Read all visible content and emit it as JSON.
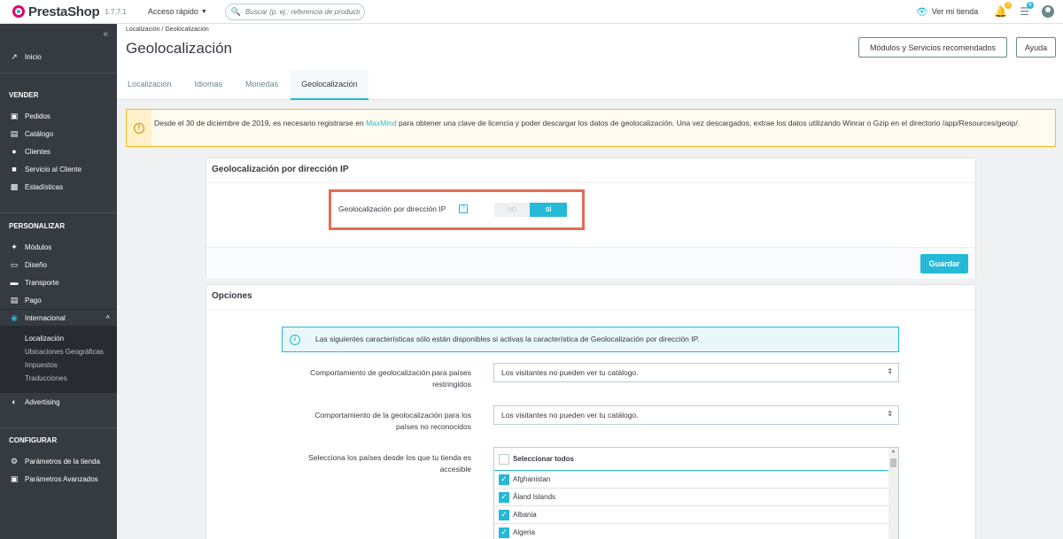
{
  "header": {
    "logo_text": "PrestaShop",
    "version": "1.7.7.1",
    "quick_access": "Acceso rápido",
    "search_placeholder": "Buscar (p. ej.: referencia de producto, nombre de cliente...)",
    "view_store": "Ver mi tienda",
    "notif_orders_count": "2",
    "notif_customers_count": "6"
  },
  "sidebar": {
    "inicio": "Inicio",
    "section_vender": "VENDER",
    "pedidos": "Pedidos",
    "catalogo": "Catálogo",
    "clientes": "Clientes",
    "servicio": "Servicio al Cliente",
    "estadisticas": "Estadísticas",
    "section_personalizar": "PERSONALIZAR",
    "modulos": "Módulos",
    "diseno": "Diseño",
    "transporte": "Transporte",
    "pago": "Pago",
    "internacional": "Internacional",
    "sub_localizacion": "Localización",
    "sub_ubicaciones": "Ubicaciones Geográficas",
    "sub_impuestos": "Impuestos",
    "sub_traducciones": "Traducciones",
    "advertising": "Advertising",
    "section_configurar": "CONFIGURAR",
    "parametros_tienda": "Parámetros de la tienda",
    "parametros_avanzados": "Parámetros Avanzados"
  },
  "page": {
    "breadcrumb": "Localización  /  Geolocalización",
    "title": "Geolocalización",
    "btn_modules": "Módulos y Servicios recomendados",
    "btn_help": "Ayuda",
    "tabs": [
      "Localización",
      "Idiomas",
      "Monedas",
      "Geolocalización"
    ]
  },
  "warning": {
    "before_link": "Desde el 30 de diciembre de 2019, es necesario registrarse en ",
    "link": "MaxMind",
    "after_link": " para obtener una clave de licencia y poder descargar los datos de geolocalización. Una vez descargados, extrae los datos utilizando Winrar o Gzip en el directorio /app/Resources/geoip/."
  },
  "panel_ip": {
    "title": "Geolocalización por dirección IP",
    "field_label": "Geolocalización por dirección IP",
    "help": "?",
    "switch_no": "NO",
    "switch_yes": "SÍ",
    "switch_value": "SÍ",
    "save": "Guardar"
  },
  "panel_options": {
    "title": "Opciones",
    "info": "Las siguientes características sólo están disponibles si activas la característica de Geolocalización por dirección IP.",
    "restricted_label": "Comportamiento de geolocalización para países restringidos",
    "restricted_value": "Los visitantes no pueden ver tu catálogo.",
    "unrecognized_label": "Comportamiento de la geolocalización para los países no reconocidos",
    "unrecognized_value": "Los visitantes no pueden ver tu catálogo.",
    "countries_label": "Selecciona los países desde los que tu tienda es accesible",
    "select_all": "Seleccionar todos",
    "countries": [
      "Afghanistan",
      "Åland Islands",
      "Albania",
      "Algeria"
    ]
  },
  "colors": {
    "accent": "#25b9d7",
    "sidebar_bg": "#363a41",
    "warning_border": "#fbbb22",
    "highlight": "#e56b55"
  }
}
